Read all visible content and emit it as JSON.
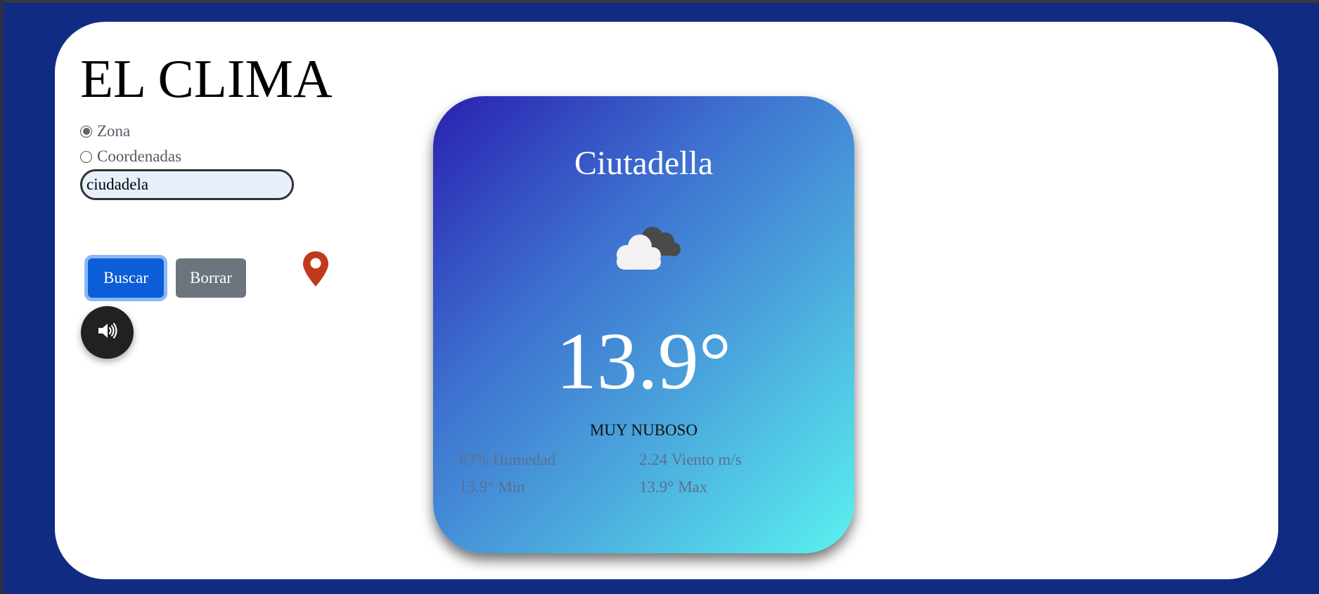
{
  "app": {
    "title": "EL CLIMA"
  },
  "search": {
    "mode_options": [
      {
        "label": "Zona",
        "selected": true
      },
      {
        "label": "Coordenadas",
        "selected": false
      }
    ],
    "value": "ciudadela",
    "search_label": "Buscar",
    "clear_label": "Borrar"
  },
  "icons": {
    "location": "map-pin-icon",
    "sound": "speaker-icon",
    "weather": "cloudy-icon"
  },
  "weather": {
    "city": "Ciutadella",
    "temperature": "13.9°",
    "description": "MUY NUBOSO",
    "humidity": "83% Humedad",
    "wind": "2.24 Viento m/s",
    "min": "13.9° Min",
    "max": "13.9° Max"
  },
  "colors": {
    "background": "#102b82",
    "search_button": "#0b5ed7",
    "clear_button": "#6c757d",
    "pin": "#c0391b",
    "card_gradient_start": "#2a20b0",
    "card_gradient_end": "#5af2f0"
  }
}
